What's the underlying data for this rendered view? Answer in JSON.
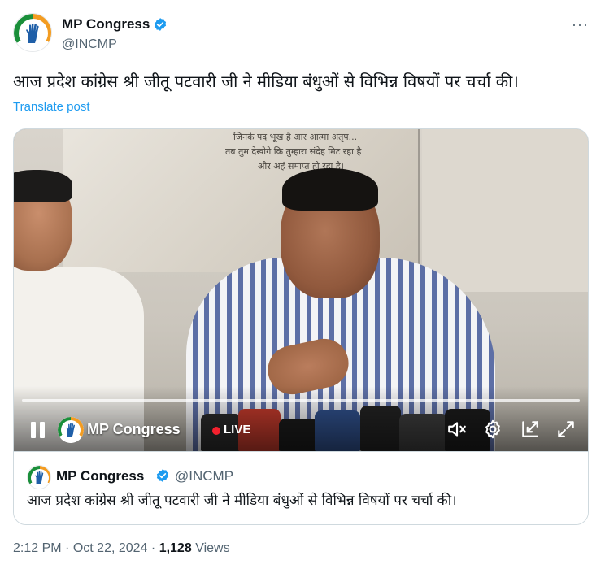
{
  "post": {
    "author": {
      "display_name": "MP Congress",
      "handle": "@INCMP",
      "verified_icon": "verified-badge-icon",
      "avatar_icon": "congress-hand-logo"
    },
    "more_label": "···",
    "text": "आज प्रदेश कांग्रेस श्री जीतू पटवारी जी ने मीडिया बंधुओं से विभिन्न विषयों पर चर्चा की।",
    "translate_label": "Translate post"
  },
  "video": {
    "poster_text_line1": "जिनके पद भूख है आर आत्मा अतृप...",
    "poster_text_line2": "तब तुम देखोगे कि तुम्हारा संदेह मिट रहा है",
    "poster_text_line3": "और अहं समाप्त हो रहा है।",
    "channel_name": "MP Congress",
    "live_label": "LIVE",
    "progress_fraction": 1.0,
    "controls": {
      "pause_icon": "pause-icon",
      "mute_icon": "mute-icon",
      "settings_icon": "gear-icon",
      "pip_icon": "picture-in-picture-icon",
      "fullscreen_icon": "fullscreen-icon"
    }
  },
  "quoted": {
    "display_name": "MP Congress",
    "handle": "@INCMP",
    "text": "आज प्रदेश कांग्रेस श्री जीतू पटवारी जी ने मीडिया बंधुओं से विभिन्न विषयों पर चर्चा की।"
  },
  "meta": {
    "time": "2:12 PM",
    "separator": "·",
    "date": "Oct 22, 2024",
    "views_count": "1,128",
    "views_label": "Views"
  },
  "colors": {
    "link": "#1d9bf0",
    "secondary_text": "#536471",
    "live_red": "#f4212e",
    "saffron": "#f39c21",
    "green": "#1a8f3a"
  }
}
